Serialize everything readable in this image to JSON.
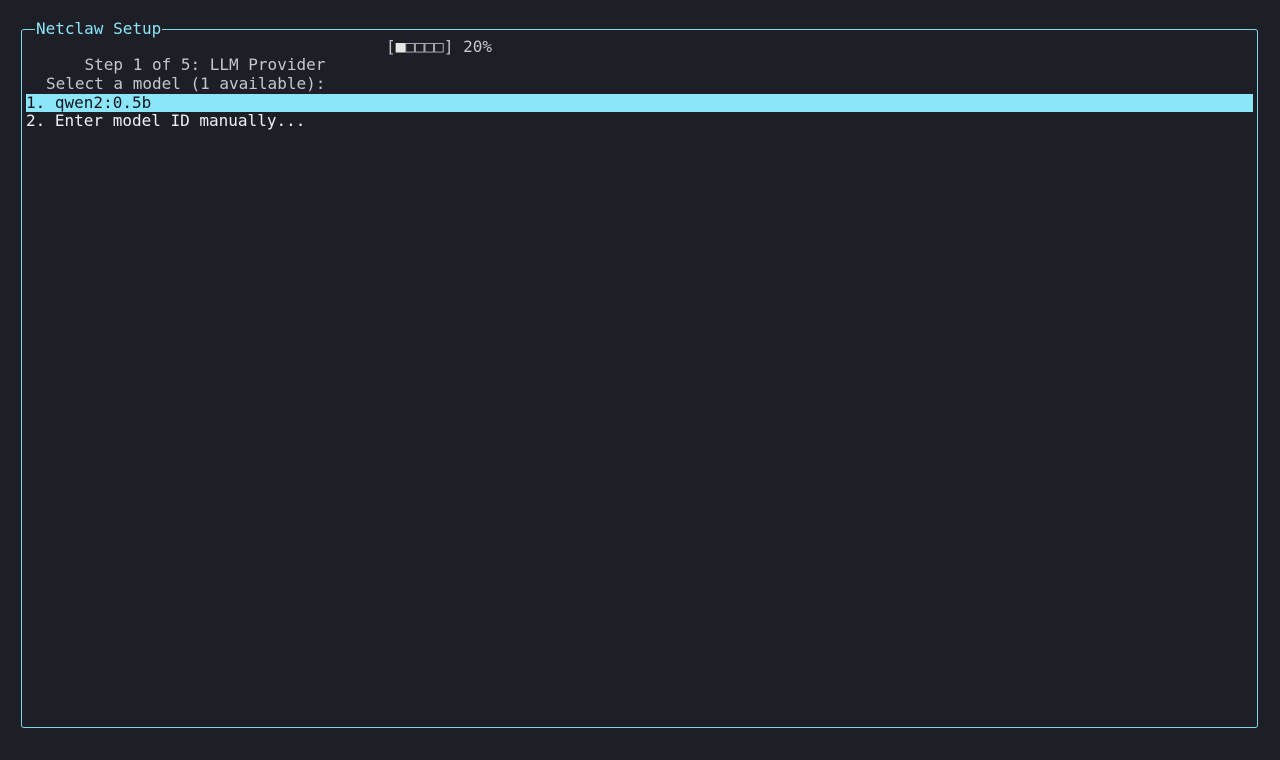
{
  "window": {
    "title": "Netclaw Setup"
  },
  "wizard": {
    "step_text": "Step 1 of 5: LLM Provider",
    "progress": {
      "open": "[",
      "filled": "■",
      "empty": "□□□□",
      "close": "]",
      "percent_text": "20%",
      "fraction": 0.2
    },
    "prompt": "Select a model (1 available):",
    "options": [
      {
        "label": "1. qwen2:0.5b",
        "selected": true
      },
      {
        "label": "2. Enter model ID manually...",
        "selected": false
      }
    ]
  },
  "colors": {
    "background": "#1e1e27",
    "accent": "#8ae6f8",
    "text": "#c8ccd4"
  }
}
